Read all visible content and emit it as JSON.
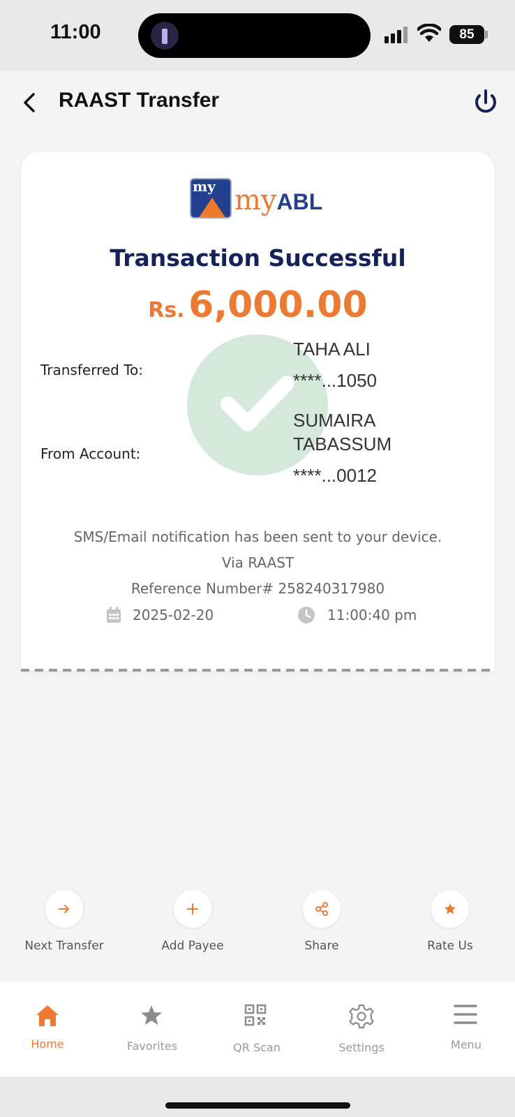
{
  "status_bar": {
    "time": "11:00",
    "battery": "85"
  },
  "header": {
    "title": "RAAST Transfer"
  },
  "receipt": {
    "logo_my": "my",
    "logo_abl": "ABL",
    "logo_box_text": "my",
    "title": "Transaction Successful",
    "currency": "Rs.",
    "amount": "6,000.00",
    "transferred_to_label": "Transferred To:",
    "transferred_to_name": "TAHA ALI",
    "transferred_to_account": "****...1050",
    "from_account_label": "From Account:",
    "from_account_name_line1": "SUMAIRA",
    "from_account_name_line2": "TABASSUM",
    "from_account_number": "****...0012",
    "notification": "SMS/Email notification has been sent to your device.",
    "via": "Via RAAST",
    "reference": "Reference Number# 258240317980",
    "date": "2025-02-20",
    "time": "11:00:40 pm"
  },
  "quick_actions": [
    {
      "label": "Next Transfer",
      "icon": "arrow-right-icon"
    },
    {
      "label": "Add Payee",
      "icon": "plus-icon"
    },
    {
      "label": "Share",
      "icon": "share-icon"
    },
    {
      "label": "Rate Us",
      "icon": "star-icon"
    }
  ],
  "bottom_nav": [
    {
      "label": "Home",
      "icon": "home-icon",
      "active": true
    },
    {
      "label": "Favorites",
      "icon": "star-icon",
      "active": false
    },
    {
      "label": "QR Scan",
      "icon": "qr-icon",
      "active": false
    },
    {
      "label": "Settings",
      "icon": "gear-icon",
      "active": false
    },
    {
      "label": "Menu",
      "icon": "hamburger-icon",
      "active": false
    }
  ],
  "colors": {
    "accent": "#ec7a33",
    "navy": "#15225a",
    "success_circle": "#d5e8dc"
  }
}
